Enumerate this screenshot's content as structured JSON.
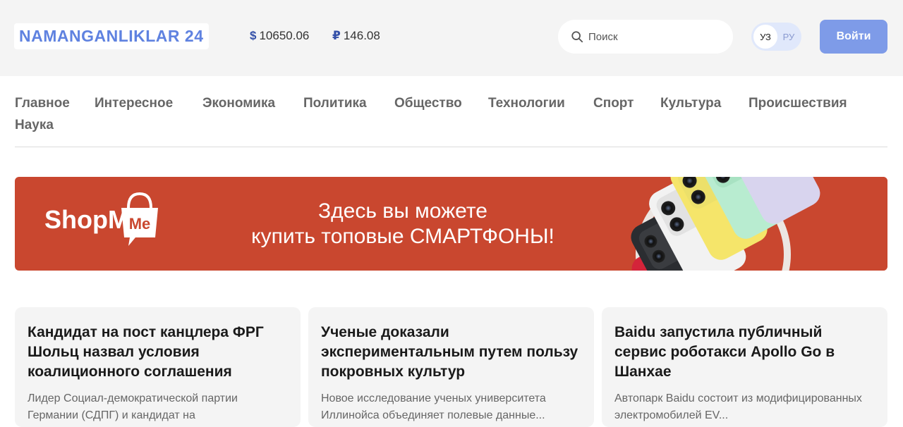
{
  "header": {
    "logo": "NAMANGANLIKLAR 24",
    "rates": {
      "usd_symbol": "$",
      "usd_value": "10650.06",
      "rub_symbol": "₽",
      "rub_value": "146.08"
    },
    "search_placeholder": "Поиск",
    "lang": {
      "active": "УЗ",
      "inactive": "РУ"
    },
    "login": "Войти"
  },
  "nav": {
    "items": [
      "Главное",
      "Интересное",
      "Экономика",
      "Политика",
      "Общество",
      "Технологии",
      "Спорт",
      "Культура",
      "Происшествия",
      "Наука"
    ]
  },
  "banner": {
    "brand": "ShopMe",
    "line1": "Здесь вы можете",
    "line2": "купить топовые СМАРТФОНЫ!",
    "bg_color": "#c9472f"
  },
  "cards": [
    {
      "title": "Кандидат на пост канцлера ФРГ Шольц назвал условия коалиционного соглашения",
      "excerpt": "Лидер Социал-демократической партии Германии (СДПГ) и кандидат на"
    },
    {
      "title": "Ученые доказали экспериментальным путем пользу покровных культур",
      "excerpt": "Новое исследование ученых университета Иллинойса объединяет полевые данные..."
    },
    {
      "title": "Baidu запустила публичный сервис роботакси Apollo Go в Шанхае",
      "excerpt": "Автопарк Baidu состоит из модифицированных электромобилей EV..."
    }
  ],
  "colors": {
    "accent": "#7e9be8",
    "logo": "#5f82e0",
    "rate_symbol": "#3450a8"
  }
}
